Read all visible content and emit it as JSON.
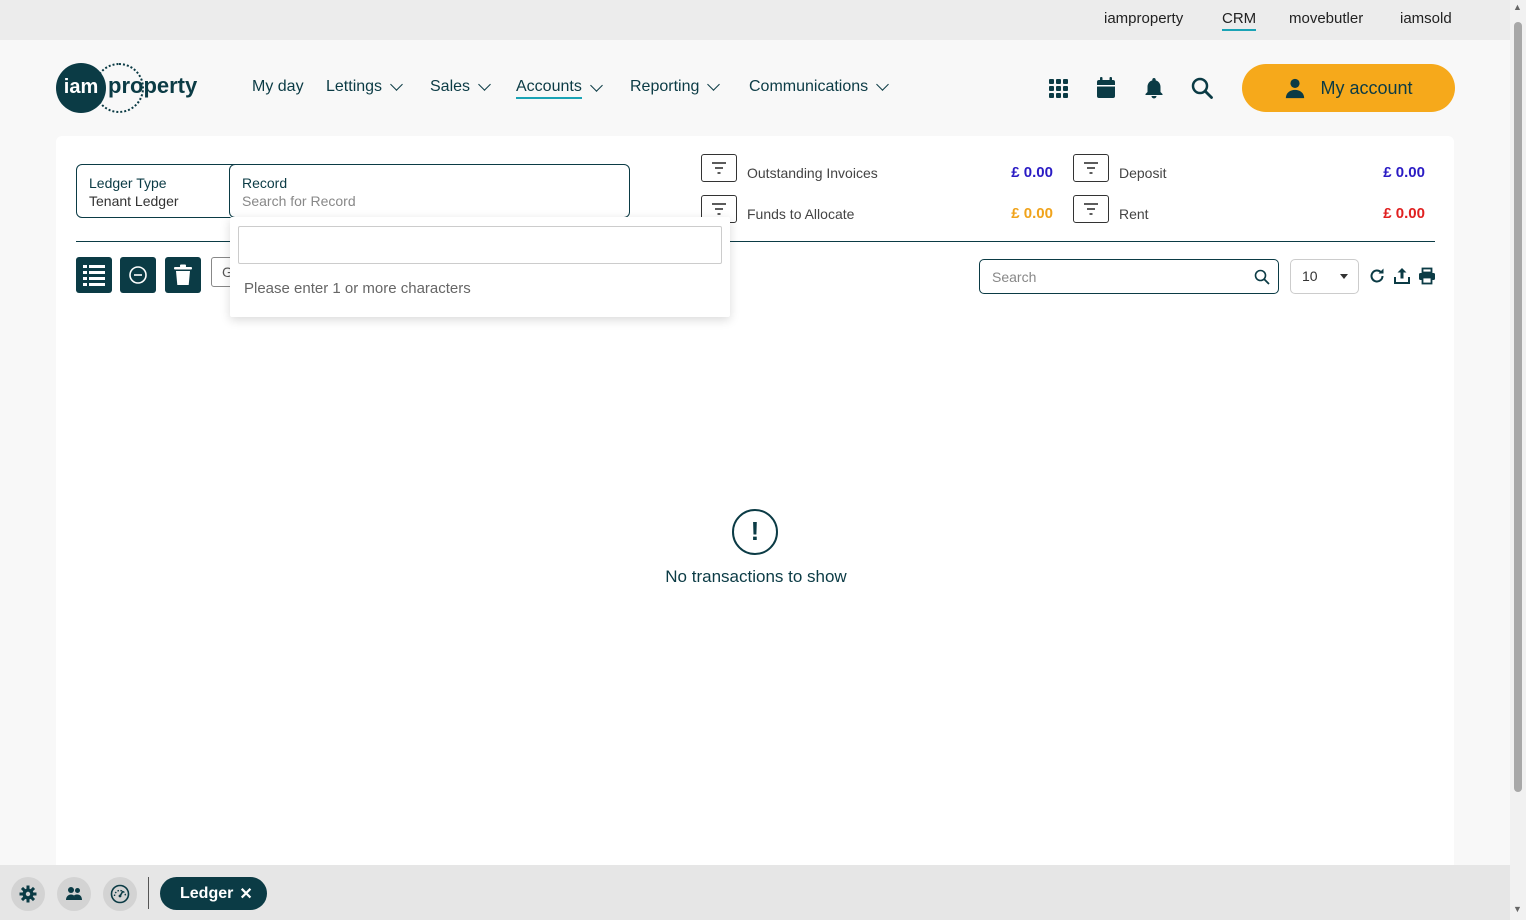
{
  "brand_links": [
    {
      "label": "iamproperty",
      "active": false
    },
    {
      "label": "CRM",
      "active": true
    },
    {
      "label": "movebutler",
      "active": false
    },
    {
      "label": "iamsold",
      "active": false
    }
  ],
  "logo": {
    "circle_text": "iam",
    "word": "property"
  },
  "nav": [
    {
      "label": "My day",
      "dropdown": false
    },
    {
      "label": "Lettings",
      "dropdown": true
    },
    {
      "label": "Sales",
      "dropdown": true
    },
    {
      "label": "Accounts",
      "dropdown": true,
      "active": true
    },
    {
      "label": "Reporting",
      "dropdown": true
    },
    {
      "label": "Communications",
      "dropdown": true
    }
  ],
  "header_icons": [
    "grid-icon",
    "calendar-icon",
    "bell-icon",
    "search-icon"
  ],
  "account_button": {
    "label": "My account",
    "color": "#f6a91b"
  },
  "filters": {
    "ledger_type": {
      "label": "Ledger Type",
      "value": "Tenant Ledger"
    },
    "record": {
      "label": "Record",
      "placeholder": "Search for Record"
    }
  },
  "summary": [
    {
      "label": "Outstanding Invoices",
      "value": "£ 0.00",
      "color": "#2a1bc4"
    },
    {
      "label": "Deposit",
      "value": "£ 0.00",
      "color": "#2a1bc4"
    },
    {
      "label": "Funds to Allocate",
      "value": "£ 0.00",
      "color": "#f0a31b"
    },
    {
      "label": "Rent",
      "value": "£ 0.00",
      "color": "#e02020"
    }
  ],
  "table_tools": {
    "search_placeholder": "Search",
    "page_size": "10",
    "partial_field_text": "G"
  },
  "empty_state": {
    "text": "No transactions to show"
  },
  "record_dropdown": {
    "input_value": "",
    "message": "Please enter 1 or more characters"
  },
  "bottom_tab": {
    "label": "Ledger"
  }
}
